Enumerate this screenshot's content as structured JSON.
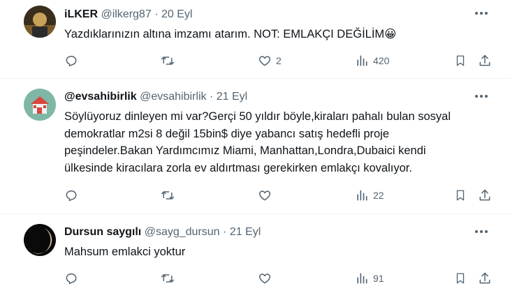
{
  "tweets": [
    {
      "name": "iLKER",
      "handle": "@ilkerg87",
      "dot": "·",
      "date": "20 Eyl",
      "text": "Yazdıklarınızın altına imzamı atarım. NOT: EMLAKÇI DEĞİLİM",
      "emoji": "😀",
      "likes": "2",
      "views": "420",
      "avatar_colors": [
        "#3a2e1c",
        "#7a5a2a",
        "#c9a25a"
      ]
    },
    {
      "name": "@evsahibirlik",
      "handle": "@evsahibirlik",
      "dot": "·",
      "date": "21 Eyl",
      "text_lines": [
        "Söylüyoruz dinleyen mi var?Gerçi 50 yıldır böyle,kiraları pahalı bulan sosyal",
        "demokratlar m2si 8 değil 15bin$ diye yabancı satış hedefli proje",
        "peşindeler.Bakan Yardımcımız Miami, Manhattan,Londra,Dubaici kendi",
        "ülkesinde kiracılara zorla ev aldırtması gerekirken emlakçı kovalıyor."
      ],
      "views": "22",
      "avatar_colors": [
        "#7fb7a6",
        "#d9463b",
        "#f2f2f2"
      ]
    },
    {
      "name": "Dursun saygılı",
      "handle": "@sayg_dursun",
      "dot": "·",
      "date": "21 Eyl",
      "text": "Mahsum emlakci yoktur",
      "views": "91",
      "avatar_colors": [
        "#0a0a0a",
        "#d8c9a8"
      ]
    }
  ],
  "icons": [
    "more-icon",
    "reply-icon",
    "retweet-icon",
    "like-icon",
    "views-icon",
    "bookmark-icon",
    "share-icon"
  ],
  "colors": {
    "text": "#0f1419",
    "secondary": "#536471",
    "divider": "#eff3f4",
    "background": "#ffffff"
  }
}
